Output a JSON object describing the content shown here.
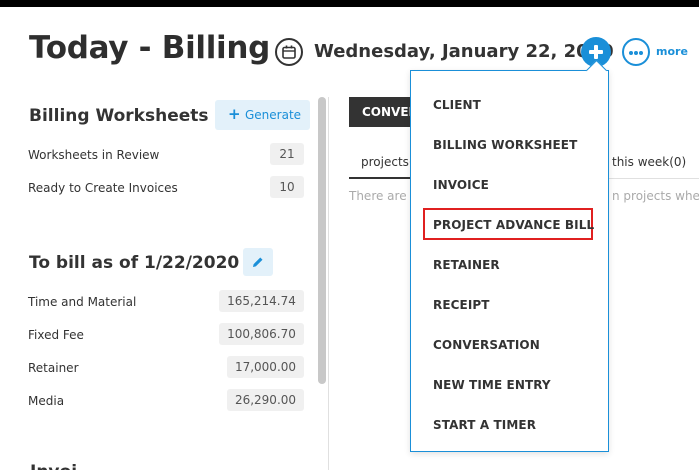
{
  "header": {
    "title": "Today - Billing",
    "date": "Wednesday, January 22, 2020",
    "more_label": "more"
  },
  "worksheets": {
    "title": "Billing Worksheets",
    "generate_label": "Generate",
    "rows": [
      {
        "label": "Worksheets in Review",
        "value": "21"
      },
      {
        "label": "Ready to Create Invoices",
        "value": "10"
      }
    ]
  },
  "to_bill": {
    "title": "To bill as of 1/22/2020",
    "rows": [
      {
        "label": "Time and Material",
        "value": "165,214.74"
      },
      {
        "label": "Fixed Fee",
        "value": "100,806.70"
      },
      {
        "label": "Retainer",
        "value": "17,000.00"
      },
      {
        "label": "Media",
        "value": "26,290.00"
      }
    ]
  },
  "bottom_section_stub": "Invoi",
  "right_panel": {
    "tab_label": "CONVERSATIONS",
    "projects_tab": "projects(",
    "week_tab": "this week(0)",
    "empty_left": "There are n",
    "empty_right": "n projects wher"
  },
  "dropdown": {
    "items": [
      "CLIENT",
      "BILLING WORKSHEET",
      "INVOICE",
      "PROJECT ADVANCE BILL",
      "RETAINER",
      "RECEIPT",
      "CONVERSATION",
      "NEW TIME ENTRY",
      "START A TIMER"
    ],
    "highlighted_index": 3
  },
  "colors": {
    "accent": "#1a8fd8",
    "highlight": "#e02020"
  }
}
